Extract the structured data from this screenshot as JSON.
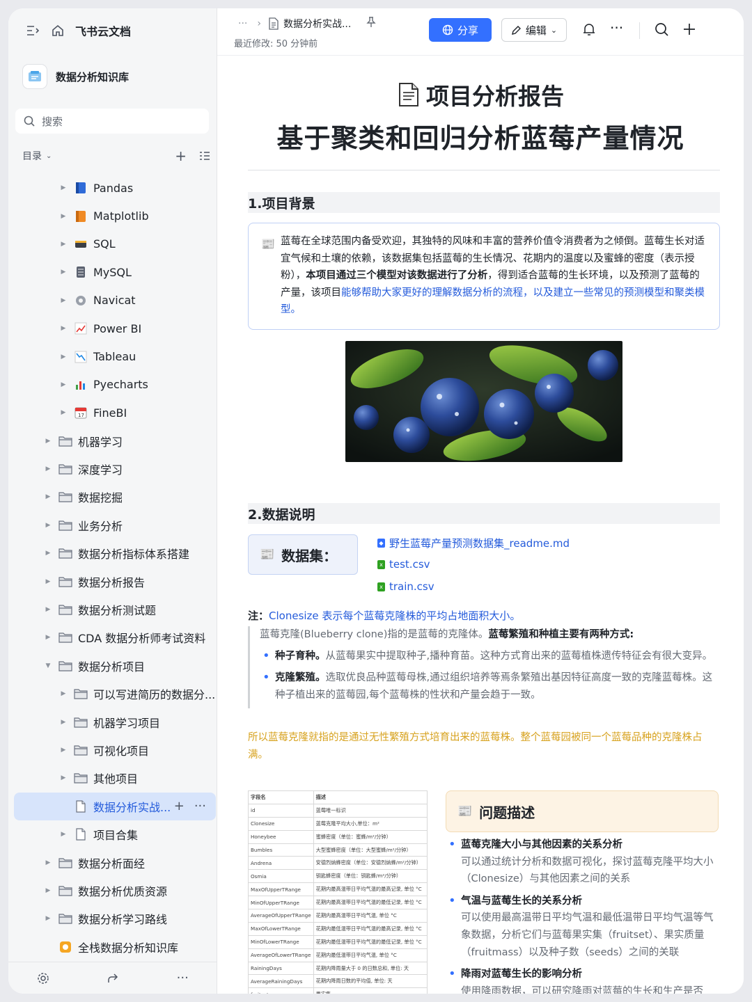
{
  "sidebar": {
    "brand": "飞书云文档",
    "kb_name": "数据分析知识库",
    "search_placeholder": "搜索",
    "toc_label": "目录",
    "tree": [
      {
        "label": "Pandas",
        "icon": "blue-book-icon",
        "level": 2
      },
      {
        "label": "Matplotlib",
        "icon": "orange-book-icon",
        "level": 2
      },
      {
        "label": "SQL",
        "icon": "database-icon",
        "level": 2
      },
      {
        "label": "MySQL",
        "icon": "server-icon",
        "level": 2
      },
      {
        "label": "Navicat",
        "icon": "gear-icon",
        "level": 2
      },
      {
        "label": "Power BI",
        "icon": "trend-chart-icon",
        "level": 2
      },
      {
        "label": "Tableau",
        "icon": "trend-down-icon",
        "level": 2
      },
      {
        "label": "Pyecharts",
        "icon": "bar-chart-icon",
        "level": 2
      },
      {
        "label": "FineBI",
        "icon": "calendar-icon",
        "level": 2
      },
      {
        "label": "机器学习",
        "icon": "folder-icon",
        "level": 1
      },
      {
        "label": "深度学习",
        "icon": "folder-icon",
        "level": 1
      },
      {
        "label": "数据挖掘",
        "icon": "folder-icon",
        "level": 1
      },
      {
        "label": "业务分析",
        "icon": "folder-icon",
        "level": 1
      },
      {
        "label": "数据分析指标体系搭建",
        "icon": "folder-icon",
        "level": 1
      },
      {
        "label": "数据分析报告",
        "icon": "folder-icon",
        "level": 1
      },
      {
        "label": "数据分析测试题",
        "icon": "folder-icon",
        "level": 1
      },
      {
        "label": "CDA 数据分析师考试资料",
        "icon": "folder-icon",
        "level": 1
      },
      {
        "label": "数据分析项目",
        "icon": "folder-icon",
        "level": 1,
        "expanded": true
      },
      {
        "label": "可以写进简历的数据分...",
        "icon": "folder-icon",
        "level": 2
      },
      {
        "label": "机器学习项目",
        "icon": "folder-icon",
        "level": 2
      },
      {
        "label": "可视化项目",
        "icon": "folder-icon",
        "level": 2
      },
      {
        "label": "其他项目",
        "icon": "folder-icon",
        "level": 2
      },
      {
        "label": "数据分析实战...",
        "icon": "doc-icon",
        "level": 2,
        "active": true
      },
      {
        "label": "项目合集",
        "icon": "doc-icon",
        "level": 2
      },
      {
        "label": "数据分析面经",
        "icon": "folder-icon",
        "level": 1
      },
      {
        "label": "数据分析优质资源",
        "icon": "folder-icon",
        "level": 1
      },
      {
        "label": "数据分析学习路线",
        "icon": "folder-icon",
        "level": 1
      },
      {
        "label": "全栈数据分析知识库",
        "icon": "orange-badge-icon",
        "level": 1,
        "no_arrow": true
      }
    ]
  },
  "header": {
    "breadcrumb_dots": "···",
    "doc_title": "数据分析实战...",
    "modified": "最近修改: 50 分钟前",
    "share_label": "分享",
    "edit_label": "编辑"
  },
  "doc": {
    "title1": "项目分析报告",
    "title2": "基于聚类和回归分析蓝莓产量情况",
    "s1_title": "1.项目背景",
    "s1_text_a": "蓝莓在全球范围内备受欢迎，其独特的风味和丰富的营养价值令消费者为之倾倒。蓝莓生长对适宜气候和土壤的依赖，该数据集包括蓝莓的生长情况、花期内的温度以及蜜蜂的密度（表示授粉），",
    "s1_text_b": "本项目通过三个模型对该数据进行了分析",
    "s1_text_c": "，得到适合蓝莓的生长环境，以及预测了蓝莓的产量，该项目",
    "s1_text_d": "能够帮助大家更好的理解数据分析的流程，以及建立一些常见的预测模型和聚类模型。",
    "s2_title": "2.数据说明",
    "dataset_label": "数据集：",
    "files": [
      "野生蓝莓产量预测数据集_readme.md",
      "test.csv",
      "train.csv"
    ],
    "note_prefix": "注：",
    "note_text": "Clonesize 表示每个蓝莓克隆株的平均占地面积大小。",
    "quote_intro_a": "蓝莓克隆(Blueberry clone)指的是蓝莓的克隆体。",
    "quote_intro_b": "蓝莓繁殖和种植主要有两种方式:",
    "bullet1_head": "种子育种。",
    "bullet1_text": "从蓝莓果实中提取种子,播种育苗。这种方式育出来的蓝莓植株遗传特征会有很大变异。",
    "bullet2_head": "克隆繁殖。",
    "bullet2_text": "选取优良品种蓝莓母株,通过组织培养等焉条繁殖出基因特征高度一致的克隆蓝莓株。这种子植出来的蓝莓园,每个蓝莓株的性状和产量会趋于一致。",
    "gold_text": "所以蓝莓克隆就指的是通过无性繁殖方式培育出来的蓝莓株。整个蓝莓园被同一个蓝莓品种的克隆株占满。",
    "table": [
      [
        "字段名",
        "描述"
      ],
      [
        "id",
        "蓝莓唯一标识"
      ],
      [
        "Clonesize",
        "蓝莓克隆平均大小,单位：m²"
      ],
      [
        "Honeybee",
        "蜜蜂密度（单位：蜜蜂/m²/分钟）"
      ],
      [
        "Bumbles",
        "大型蜜蜂密度（单位：大型蜜蜂/m²/分钟）"
      ],
      [
        "Andrena",
        "安德烈纳蜂密度（单位：安德烈纳蜂/m²/分钟）"
      ],
      [
        "Osmia",
        "钥匙蜂密度（单位：钥匙蜂/m²/分钟）"
      ],
      [
        "MaxOfUpperTRange",
        "花期内最高温带日平均气温的最高记录, 单位 °C"
      ],
      [
        "MinOfUpperTRange",
        "花期内最高温带日平均气温的最低记录, 单位 °C"
      ],
      [
        "AverageOfUpperTRange",
        "花期内最高温带日平均气温, 单位 °C"
      ],
      [
        "MaxOfLowerTRange",
        "花期内最低温带日平均气温的最高记录, 单位 °C"
      ],
      [
        "MinOfLowerTRange",
        "花期内最低温带日平均气温的最低记录, 单位 °C"
      ],
      [
        "AverageOfLowerTRange",
        "花期内最低温带日平均气温, 单位 °C"
      ],
      [
        "RainingDays",
        "花期内降雨量大于 0 的日数总和, 单位: 天"
      ],
      [
        "AverageRainingDays",
        "花期内降雨日数的平均值, 单位: 天"
      ],
      [
        "fruitset",
        "果实集"
      ]
    ],
    "problem_title": "问题描述",
    "problems": [
      {
        "head": "蓝莓克隆大小与其他因素的关系分析",
        "text": "可以通过统计分析和数据可视化，探讨蓝莓克隆平均大小（Clonesize）与其他因素之间的关系"
      },
      {
        "head": "气温与蓝莓生长的关系分析",
        "text": "可以使用最高温带日平均气温和最低温带日平均气温等气象数据，分析它们与蓝莓果实集（fruitset）、果实质量（fruitmass）以及种子数（seeds）之间的关联"
      },
      {
        "head": "降雨对蓝莓生长的影响分析",
        "text": "使用降雨数据，可以研究降雨对蓝莓的生长和生产是否"
      }
    ]
  },
  "colors": {
    "accent": "#3370ff",
    "link": "#245bdb",
    "gold": "#d7a21e"
  }
}
